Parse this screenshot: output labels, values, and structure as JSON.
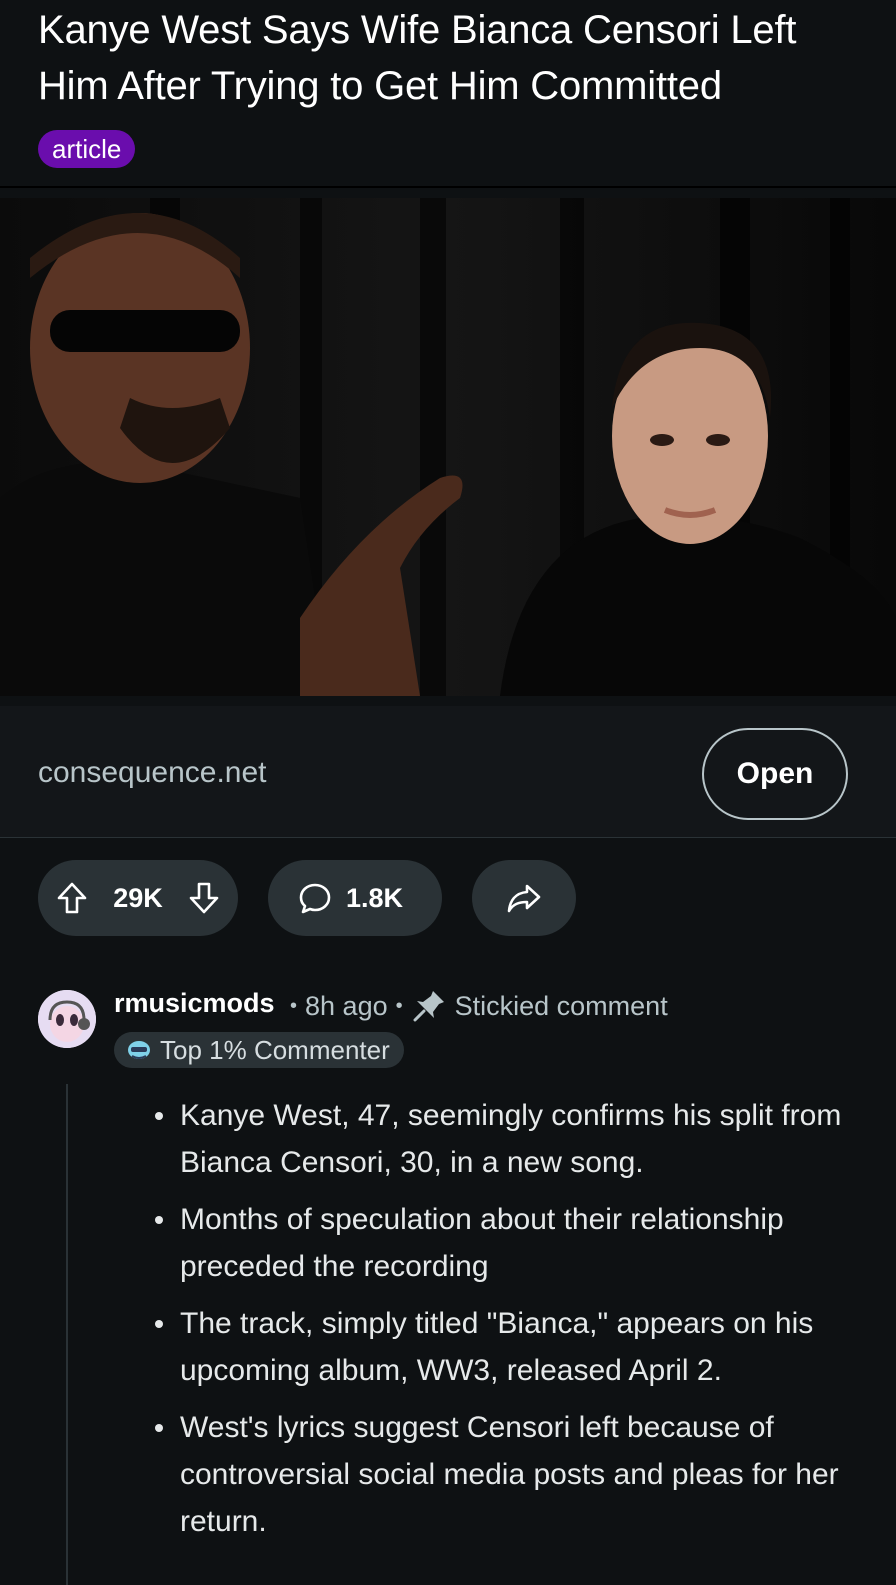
{
  "post": {
    "title": "Kanye West Says Wife Bianca Censori Left Him After Trying to Get Him Committed",
    "flair": "article",
    "flair_color": "#6a0dad",
    "link_domain": "consequence.net",
    "open_label": "Open"
  },
  "actions": {
    "upvote_icon": "arrow-up-icon",
    "score": "29K",
    "downvote_icon": "arrow-down-icon",
    "comment_icon": "speech-bubble-icon",
    "comments": "1.8K",
    "share_icon": "share-icon"
  },
  "comment": {
    "username": "rmusicmods",
    "age": "8h ago",
    "stickied_label": "Stickied comment",
    "badge": "Top 1% Commenter",
    "bullets": [
      "Kanye West, 47, seemingly confirms his split from Bianca Censori, 30, in a new song.",
      "Months of speculation about their relationship preceded the recording",
      "The track, simply titled \"Bianca,\" appears on his upcoming album, WW3, released April 2.",
      "West's lyrics suggest Censori left because of controversial social media posts and pleas for her return."
    ]
  },
  "colors": {
    "background": "#0e1113",
    "pill": "#2a3236",
    "muted_text": "#b8c5c9"
  }
}
